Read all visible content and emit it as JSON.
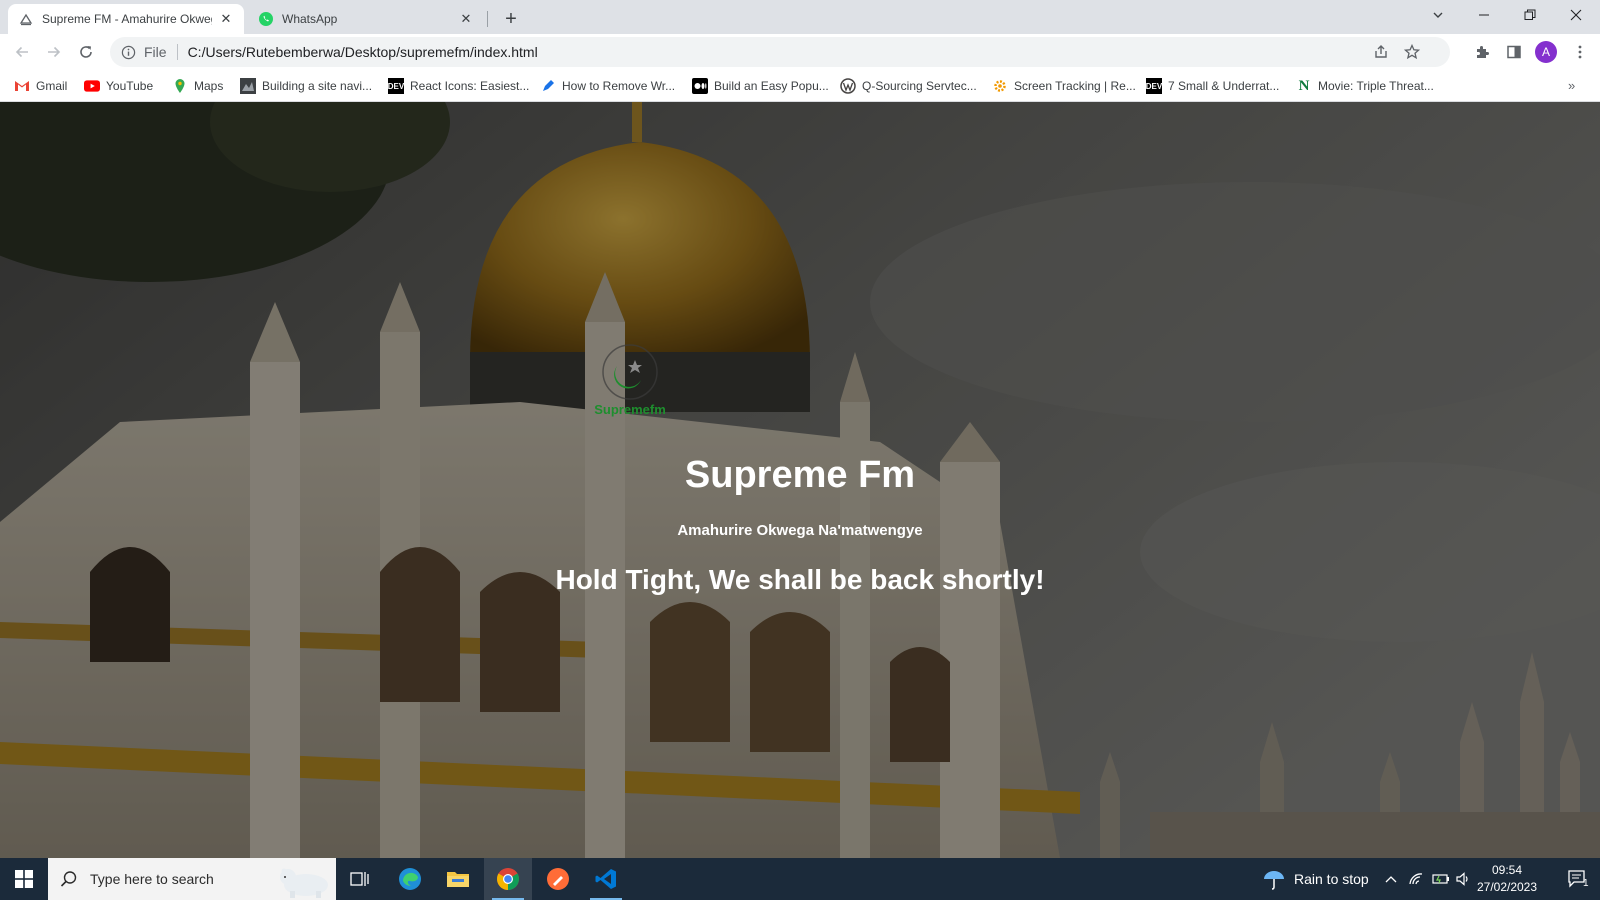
{
  "browser": {
    "tabs": [
      {
        "title": "Supreme FM - Amahurire Okwega Na'matwengye",
        "active": true
      },
      {
        "title": "WhatsApp",
        "active": false
      }
    ],
    "address": {
      "scheme": "File",
      "url": "C:/Users/Rutebemberwa/Desktop/supremefm/index.html"
    },
    "profile_initial": "A",
    "bookmarks": [
      {
        "label": "Gmail",
        "icon": "gmail-icon"
      },
      {
        "label": "YouTube",
        "icon": "youtube-icon"
      },
      {
        "label": "Maps",
        "icon": "maps-icon"
      },
      {
        "label": "Building a site navi...",
        "icon": "site-icon"
      },
      {
        "label": "React Icons: Easiest...",
        "icon": "dev-icon"
      },
      {
        "label": "How to Remove Wr...",
        "icon": "pen-icon"
      },
      {
        "label": "Build an Easy Popu...",
        "icon": "medium-icon"
      },
      {
        "label": "Q-Sourcing Servtec...",
        "icon": "wordpress-icon"
      },
      {
        "label": "Screen Tracking | Re...",
        "icon": "gear-icon"
      },
      {
        "label": "7 Small & Underrat...",
        "icon": "dev-icon"
      },
      {
        "label": "Movie: Triple Threat...",
        "icon": "n-icon"
      }
    ]
  },
  "page": {
    "logo_text": "Supremefm",
    "title": "Supreme Fm",
    "subtitle": "Amahurire Okwega Na'matwengye",
    "message": "Hold Tight, We shall be back shortly!"
  },
  "taskbar": {
    "search_placeholder": "Type here to search",
    "weather": "Rain to stop",
    "time": "09:54",
    "date": "27/02/2023",
    "notification_count": "1"
  }
}
